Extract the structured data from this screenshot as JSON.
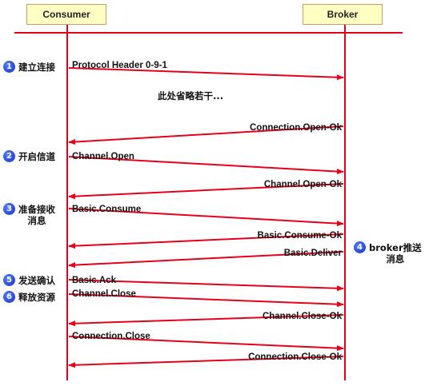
{
  "actors": {
    "consumer": "Consumer",
    "broker": "Broker"
  },
  "note": "此处省略若干...",
  "steps": [
    {
      "num": "1",
      "label": "建立连接"
    },
    {
      "num": "2",
      "label": "开启信道"
    },
    {
      "num": "3",
      "label": "准备接收\n消息"
    },
    {
      "num": "4",
      "label": "broker推送\n消息"
    },
    {
      "num": "5",
      "label": "发送确认"
    },
    {
      "num": "6",
      "label": "释放资源"
    }
  ],
  "messages": [
    {
      "text": "Protocol Header 0-9-1",
      "direction": "to-broker"
    },
    {
      "text": "Connection.Open-Ok",
      "direction": "to-consumer"
    },
    {
      "text": "Channel.Open",
      "direction": "to-broker"
    },
    {
      "text": "Channel.Open-Ok",
      "direction": "to-consumer"
    },
    {
      "text": "Basic.Consume",
      "direction": "to-broker"
    },
    {
      "text": "Basic.Consume-Ok",
      "direction": "to-consumer"
    },
    {
      "text": "Basic.Deliver",
      "direction": "to-consumer"
    },
    {
      "text": "Basic.Ack",
      "direction": "to-broker"
    },
    {
      "text": "Channel.Close",
      "direction": "to-broker"
    },
    {
      "text": "Channel.Close-Ok",
      "direction": "to-consumer"
    },
    {
      "text": "Connection.Close",
      "direction": "to-broker"
    },
    {
      "text": "Connection.Close-Ok",
      "direction": "to-consumer"
    }
  ],
  "colors": {
    "arrow": "#e8001a",
    "lifeline": "#e8001a",
    "actor_fill": "#ffffc4",
    "step_badge": "#1a2fb5"
  }
}
